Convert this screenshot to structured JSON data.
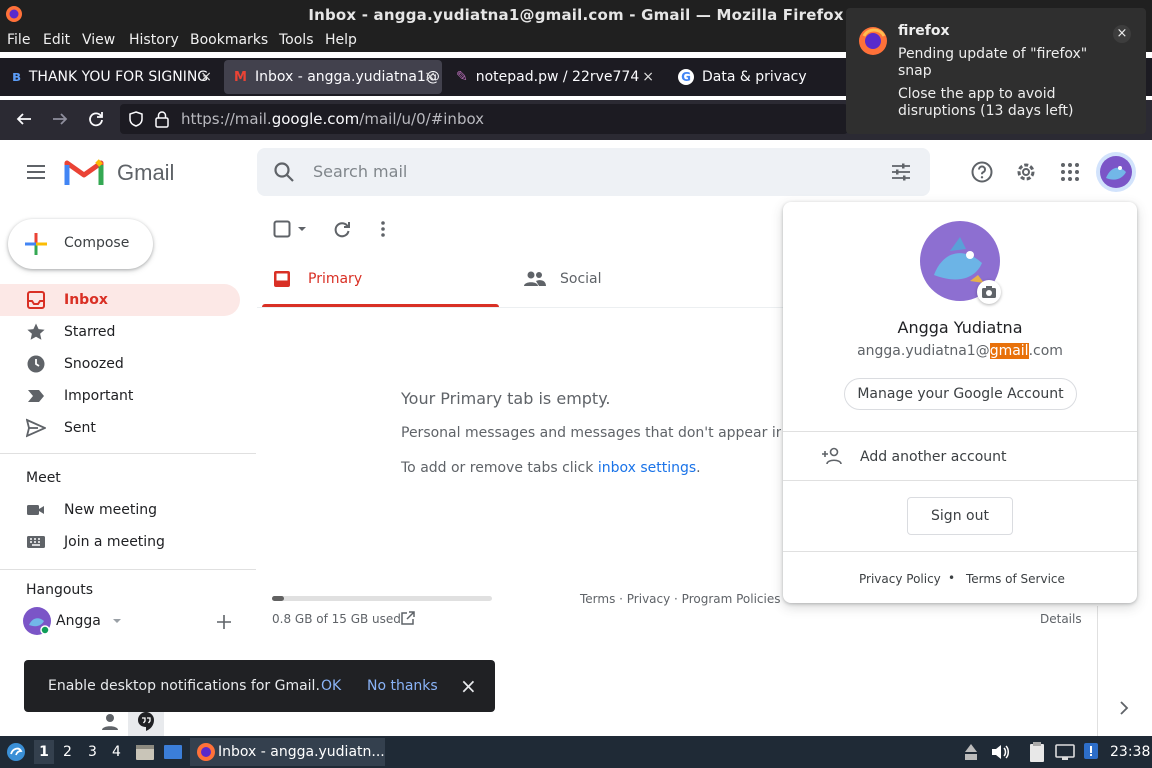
{
  "window": {
    "title": "Inbox - angga.yudiatna1@gmail.com - Gmail — Mozilla Firefox"
  },
  "menu": [
    "File",
    "Edit",
    "View",
    "History",
    "Bookmarks",
    "Tools",
    "Help"
  ],
  "tabs": [
    {
      "label": "THANK YOU FOR SIGNING",
      "close": "×"
    },
    {
      "label": "Inbox - angga.yudiatna1@",
      "close": "×"
    },
    {
      "label": "notepad.pw / 22rve774",
      "close": "×"
    },
    {
      "label": "Data & privacy"
    }
  ],
  "address": {
    "prefix": "https://mail.",
    "host": "google.com",
    "path": "/mail/u/0/#inbox"
  },
  "notification": {
    "app": "firefox",
    "line1": "Pending update of \"firefox\" snap",
    "line2": "Close the app to avoid disruptions (13 days left)",
    "close": "×"
  },
  "gmail": {
    "brand": "Gmail",
    "search_placeholder": "Search mail",
    "compose": "Compose",
    "nav": [
      "Inbox",
      "Starred",
      "Snoozed",
      "Important",
      "Sent"
    ],
    "meet": {
      "heading": "Meet",
      "items": [
        "New meeting",
        "Join a meeting"
      ]
    },
    "hangouts": {
      "heading": "Hangouts",
      "user": "Angga"
    },
    "tabs": [
      "Primary",
      "Social"
    ],
    "empty": {
      "title": "Your Primary tab is empty.",
      "desc": "Personal messages and messages that don't appear in other t",
      "settings_prefix": "To add or remove tabs click ",
      "settings_link": "inbox settings",
      "settings_suffix": "."
    },
    "storage": {
      "text": "0.8 GB of 15 GB used",
      "used_fraction": 0.053
    },
    "footer": {
      "links": "Terms · Privacy · Program Policies",
      "details": "Details"
    }
  },
  "account": {
    "name": "Angga Yudiatna",
    "email_pre": "angga.yudiatna1@",
    "email_hl": "gmail",
    "email_post": ".com",
    "manage": "Manage your Google Account",
    "add": "Add another account",
    "signout": "Sign out",
    "privacy": "Privacy Policy",
    "dot": "•",
    "terms": "Terms of Service"
  },
  "snackbar": {
    "text": "Enable desktop notifications for Gmail.",
    "ok": "OK",
    "no": "No thanks",
    "close": "×"
  },
  "taskbar": {
    "workspaces": [
      "1",
      "2",
      "3",
      "4"
    ],
    "window": "Inbox - angga.yudiatn...",
    "clock": "23:38"
  },
  "colors": {
    "gmail_red": "#d93025",
    "link_blue": "#1a73e8",
    "highlight": "#e8710a"
  }
}
